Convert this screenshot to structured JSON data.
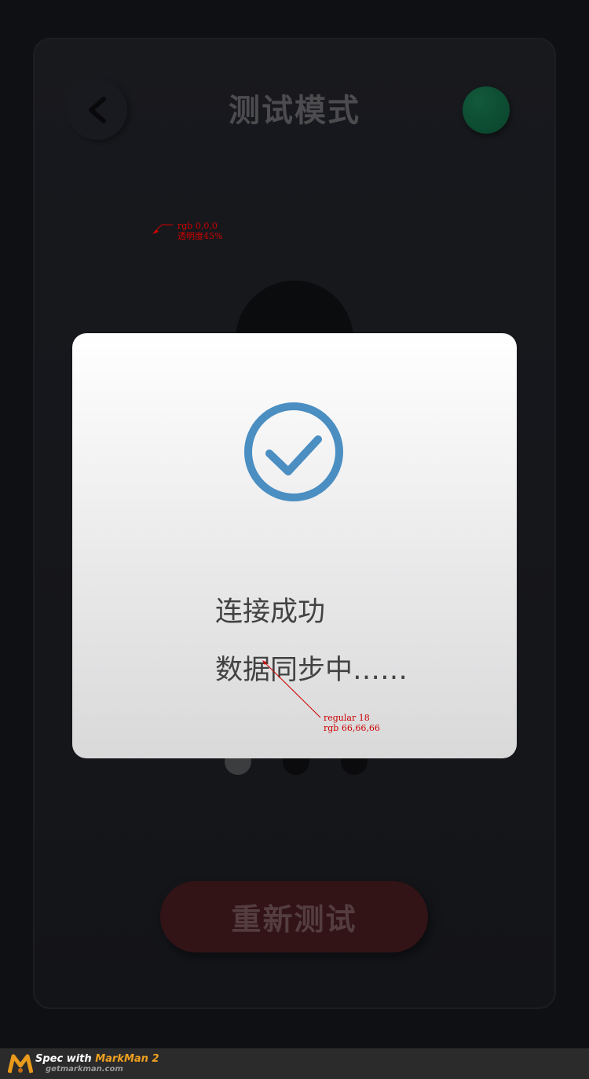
{
  "header": {
    "title": "测试模式",
    "back_icon": "chevron-left-icon",
    "status_color": "#1a8f5e"
  },
  "main": {
    "retest_label": "重新测试",
    "page_indicator": {
      "total": 3,
      "active": 1
    }
  },
  "dialog": {
    "icon": "check-circle-icon",
    "icon_color": "#4a8ec2",
    "line1": "连接成功",
    "line2": "数据同步中……"
  },
  "annotations": {
    "overlay": {
      "line1": "rgb 0,0,0",
      "line2": "透明度45%"
    },
    "text_spec": {
      "line1": "regular 18",
      "line2": "rgb 66,66,66"
    }
  },
  "footer": {
    "brand_prefix": "Spec with ",
    "brand_name": "MarkMan 2",
    "url": "getmarkman.com"
  }
}
